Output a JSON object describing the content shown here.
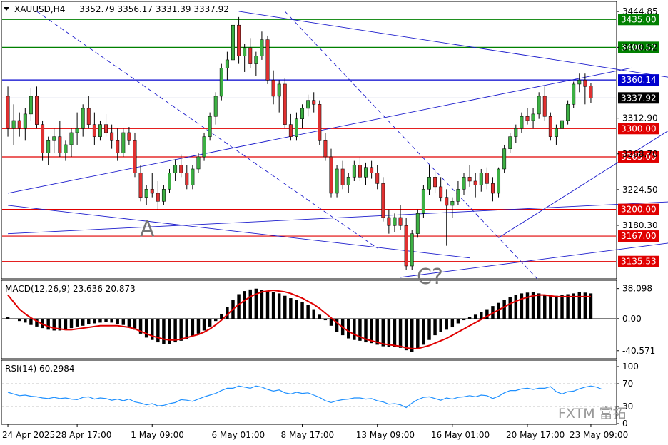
{
  "chart_data": [
    {
      "type": "candlestick",
      "title": "XAUUSD,H4",
      "ohlc_label": "3352.79 3356.17 3331.39 3337.92",
      "ylim": [
        3115,
        3452
      ],
      "y_ticks": [
        "3444.85",
        "3400.52",
        "3312.90",
        "3268.70",
        "3224.50",
        "3180.30"
      ],
      "x_ticks": [
        "24 Apr 2025",
        "28 Apr 17:00",
        "1 May 09:00",
        "6 May 01:00",
        "8 May 17:00",
        "13 May 09:00",
        "16 May 01:00",
        "20 May 17:00",
        "23 May 09:00"
      ],
      "candles": [
        [
          3340,
          3352,
          3290,
          3300
        ],
        [
          3300,
          3330,
          3280,
          3310
        ],
        [
          3310,
          3320,
          3290,
          3300
        ],
        [
          3300,
          3325,
          3285,
          3318
        ],
        [
          3318,
          3350,
          3310,
          3340
        ],
        [
          3340,
          3352,
          3300,
          3305
        ],
        [
          3305,
          3310,
          3260,
          3270
        ],
        [
          3270,
          3290,
          3255,
          3285
        ],
        [
          3285,
          3300,
          3270,
          3290
        ],
        [
          3290,
          3310,
          3265,
          3270
        ],
        [
          3270,
          3285,
          3260,
          3280
        ],
        [
          3280,
          3300,
          3265,
          3295
        ],
        [
          3295,
          3320,
          3280,
          3300
        ],
        [
          3300,
          3330,
          3290,
          3325
        ],
        [
          3325,
          3340,
          3300,
          3305
        ],
        [
          3305,
          3320,
          3280,
          3290
        ],
        [
          3290,
          3310,
          3285,
          3305
        ],
        [
          3305,
          3318,
          3290,
          3295
        ],
        [
          3295,
          3305,
          3275,
          3285
        ],
        [
          3285,
          3300,
          3260,
          3270
        ],
        [
          3270,
          3300,
          3265,
          3295
        ],
        [
          3295,
          3302,
          3280,
          3285
        ],
        [
          3285,
          3295,
          3240,
          3245
        ],
        [
          3245,
          3255,
          3210,
          3215
        ],
        [
          3215,
          3230,
          3205,
          3225
        ],
        [
          3225,
          3245,
          3215,
          3220
        ],
        [
          3220,
          3235,
          3200,
          3210
        ],
        [
          3210,
          3230,
          3205,
          3225
        ],
        [
          3225,
          3250,
          3220,
          3245
        ],
        [
          3245,
          3262,
          3235,
          3255
        ],
        [
          3255,
          3268,
          3240,
          3245
        ],
        [
          3245,
          3255,
          3225,
          3230
        ],
        [
          3230,
          3255,
          3225,
          3250
        ],
        [
          3250,
          3270,
          3245,
          3265
        ],
        [
          3265,
          3295,
          3260,
          3290
        ],
        [
          3290,
          3320,
          3285,
          3315
        ],
        [
          3315,
          3345,
          3305,
          3340
        ],
        [
          3340,
          3380,
          3335,
          3375
        ],
        [
          3375,
          3395,
          3360,
          3385
        ],
        [
          3385,
          3435,
          3380,
          3428
        ],
        [
          3428,
          3438,
          3380,
          3390
        ],
        [
          3390,
          3405,
          3370,
          3400
        ],
        [
          3400,
          3412,
          3375,
          3380
        ],
        [
          3380,
          3395,
          3365,
          3390
        ],
        [
          3390,
          3420,
          3385,
          3410
        ],
        [
          3410,
          3415,
          3355,
          3360
        ],
        [
          3360,
          3372,
          3330,
          3340
        ],
        [
          3340,
          3360,
          3320,
          3355
        ],
        [
          3355,
          3362,
          3300,
          3305
        ],
        [
          3305,
          3318,
          3285,
          3290
        ],
        [
          3290,
          3320,
          3285,
          3312
        ],
        [
          3312,
          3330,
          3300,
          3325
        ],
        [
          3325,
          3342,
          3315,
          3335
        ],
        [
          3335,
          3345,
          3320,
          3330
        ],
        [
          3330,
          3335,
          3280,
          3285
        ],
        [
          3285,
          3295,
          3260,
          3265
        ],
        [
          3265,
          3275,
          3215,
          3220
        ],
        [
          3220,
          3255,
          3215,
          3250
        ],
        [
          3250,
          3260,
          3225,
          3230
        ],
        [
          3230,
          3245,
          3220,
          3240
        ],
        [
          3240,
          3260,
          3235,
          3255
        ],
        [
          3255,
          3265,
          3235,
          3240
        ],
        [
          3240,
          3258,
          3230,
          3252
        ],
        [
          3252,
          3260,
          3238,
          3245
        ],
        [
          3245,
          3255,
          3225,
          3232
        ],
        [
          3232,
          3240,
          3185,
          3190
        ],
        [
          3190,
          3200,
          3170,
          3180
        ],
        [
          3180,
          3195,
          3172,
          3190
        ],
        [
          3190,
          3205,
          3175,
          3180
        ],
        [
          3180,
          3190,
          3125,
          3130
        ],
        [
          3130,
          3175,
          3125,
          3170
        ],
        [
          3170,
          3200,
          3165,
          3195
        ],
        [
          3195,
          3230,
          3190,
          3225
        ],
        [
          3225,
          3255,
          3218,
          3240
        ],
        [
          3240,
          3248,
          3220,
          3228
        ],
        [
          3228,
          3240,
          3210,
          3215
        ],
        [
          3215,
          3225,
          3155,
          3205
        ],
        [
          3205,
          3215,
          3190,
          3210
        ],
        [
          3210,
          3235,
          3205,
          3225
        ],
        [
          3225,
          3245,
          3218,
          3240
        ],
        [
          3240,
          3255,
          3228,
          3235
        ],
        [
          3235,
          3245,
          3215,
          3230
        ],
        [
          3230,
          3250,
          3222,
          3245
        ],
        [
          3245,
          3252,
          3225,
          3232
        ],
        [
          3232,
          3240,
          3210,
          3220
        ],
        [
          3220,
          3252,
          3215,
          3250
        ],
        [
          3250,
          3280,
          3245,
          3275
        ],
        [
          3275,
          3295,
          3270,
          3290
        ],
        [
          3290,
          3305,
          3282,
          3300
        ],
        [
          3300,
          3320,
          3295,
          3315
        ],
        [
          3315,
          3325,
          3305,
          3310
        ],
        [
          3310,
          3325,
          3300,
          3318
        ],
        [
          3318,
          3345,
          3312,
          3340
        ],
        [
          3340,
          3352,
          3310,
          3315
        ],
        [
          3315,
          3320,
          3285,
          3290
        ],
        [
          3290,
          3305,
          3280,
          3300
        ],
        [
          3300,
          3315,
          3292,
          3310
        ],
        [
          3310,
          3335,
          3305,
          3330
        ],
        [
          3330,
          3358,
          3325,
          3355
        ],
        [
          3355,
          3368,
          3345,
          3360
        ],
        [
          3360,
          3368,
          3330,
          3352
        ],
        [
          3352.79,
          3356.17,
          3331.39,
          3337.92
        ]
      ],
      "horizontal_lines": [
        {
          "price": 3435.0,
          "label": "3435.00",
          "color": "#008000"
        },
        {
          "price": 3400.52,
          "label": "3400.52",
          "color": "#008000"
        },
        {
          "price": 3360.14,
          "label": "3360.14",
          "color": "#0000cd"
        },
        {
          "price": 3300.0,
          "label": "3300.00",
          "color": "#e00000"
        },
        {
          "price": 3265.0,
          "label": "3265.00",
          "color": "#e00000"
        },
        {
          "price": 3200.0,
          "label": "3200.00",
          "color": "#e00000"
        },
        {
          "price": 3167.0,
          "label": "3167.00",
          "color": "#e00000"
        },
        {
          "price": 3135.53,
          "label": "3135.53",
          "color": "#e00000"
        }
      ],
      "current_price": {
        "label": "3337.92",
        "color": "#000000"
      },
      "trendlines_solid": [
        [
          [
            0,
            3220
          ],
          [
            108,
            3375
          ]
        ],
        [
          [
            0,
            3170
          ],
          [
            125,
            3213
          ]
        ],
        [
          [
            0,
            3205
          ],
          [
            80,
            3140
          ]
        ],
        [
          [
            40,
            3445
          ],
          [
            125,
            3352
          ]
        ],
        [
          [
            68,
            3116
          ],
          [
            125,
            3168
          ]
        ],
        [
          [
            85,
            3165
          ],
          [
            125,
            3345
          ]
        ]
      ],
      "trendlines_dashed": [
        [
          [
            5,
            3445
          ],
          [
            64,
            3152
          ]
        ],
        [
          [
            48,
            3445
          ],
          [
            92,
            3112
          ]
        ]
      ],
      "annotations": [
        "A",
        "C?"
      ],
      "watermark": "FXTM 富拓",
      "colors": {
        "up": "#3cb043",
        "down": "#e03030",
        "wick": "#000000"
      }
    },
    {
      "type": "macd_histogram",
      "title": "MACD(12,26,9) 23.636 20.873",
      "y_ticks": [
        "38.098",
        "0.00",
        "-40.571"
      ],
      "ylim": [
        -48,
        45
      ],
      "histogram": [
        2,
        -1,
        -3,
        -5,
        -8,
        -10,
        -12,
        -14,
        -15,
        -15,
        -14,
        -12,
        -10,
        -9,
        -7,
        -6,
        -5,
        -4,
        -5,
        -7,
        -8,
        -10,
        -14,
        -19,
        -24,
        -27,
        -30,
        -32,
        -32,
        -30,
        -28,
        -26,
        -22,
        -19,
        -15,
        -10,
        -3,
        6,
        15,
        24,
        31,
        35,
        37,
        38,
        36,
        35,
        34,
        32,
        29,
        26,
        24,
        21,
        17,
        12,
        5,
        -2,
        -9,
        -17,
        -21,
        -25,
        -27,
        -28,
        -30,
        -31,
        -33,
        -35,
        -36,
        -36,
        -37,
        -40,
        -42,
        -38,
        -33,
        -27,
        -21,
        -17,
        -14,
        -11,
        -6,
        -2,
        2,
        5,
        8,
        12,
        16,
        20,
        24,
        27,
        30,
        32,
        33,
        34,
        32,
        30,
        29,
        29,
        30,
        31,
        32,
        34,
        33,
        32
      ],
      "signal": [
        30,
        21,
        12,
        6,
        1,
        -3,
        -7,
        -10,
        -12,
        -13,
        -14,
        -14,
        -13,
        -12,
        -11,
        -10,
        -9,
        -9,
        -9,
        -9,
        -10,
        -11,
        -13,
        -16,
        -19,
        -22,
        -24,
        -26,
        -27,
        -27,
        -26,
        -24,
        -22,
        -20,
        -17,
        -13,
        -8,
        -2,
        5,
        12,
        18,
        23,
        28,
        31,
        34,
        35,
        36,
        35,
        34,
        32,
        29,
        26,
        22,
        18,
        13,
        7,
        1,
        -5,
        -11,
        -16,
        -20,
        -23,
        -26,
        -28,
        -30,
        -32,
        -33,
        -34,
        -35,
        -37,
        -38,
        -38,
        -36,
        -34,
        -31,
        -28,
        -25,
        -21,
        -17,
        -13,
        -9,
        -5,
        -1,
        3,
        7,
        11,
        15,
        19,
        22,
        25,
        27,
        29,
        30,
        30,
        29,
        28,
        28,
        28,
        28,
        28,
        28,
        28
      ]
    },
    {
      "type": "line",
      "title": "RSI(14) 60.2984",
      "y_ticks": [
        "100",
        "70",
        "30",
        "0"
      ],
      "ylim": [
        0,
        100
      ],
      "levels": [
        70,
        30
      ],
      "values": [
        55,
        52,
        49,
        50,
        48,
        47,
        45,
        44,
        46,
        44,
        45,
        43,
        42,
        46,
        47,
        43,
        45,
        44,
        41,
        43,
        40,
        43,
        38,
        36,
        33,
        35,
        31,
        32,
        35,
        37,
        42,
        41,
        39,
        43,
        47,
        50,
        53,
        58,
        62,
        62,
        66,
        64,
        62,
        66,
        64,
        60,
        57,
        59,
        54,
        52,
        55,
        53,
        54,
        50,
        46,
        40,
        37,
        40,
        42,
        43,
        45,
        45,
        43,
        44,
        40,
        38,
        34,
        35,
        33,
        28,
        36,
        42,
        46,
        47,
        44,
        41,
        45,
        43,
        46,
        47,
        49,
        47,
        50,
        49,
        44,
        48,
        54,
        58,
        58,
        61,
        62,
        60,
        62,
        62,
        65,
        56,
        52,
        56,
        57,
        61,
        64,
        66,
        64,
        60
      ]
    }
  ],
  "text": {
    "title": "XAUUSD,H4",
    "ohlc": "3352.79 3356.17 3331.39 3337.92",
    "macd_title": "MACD(12,26,9) 23.636 20.873",
    "rsi_title": "RSI(14) 60.2984",
    "label_a": "A",
    "label_c": "C?",
    "watermark": "FXTM 富拓"
  }
}
